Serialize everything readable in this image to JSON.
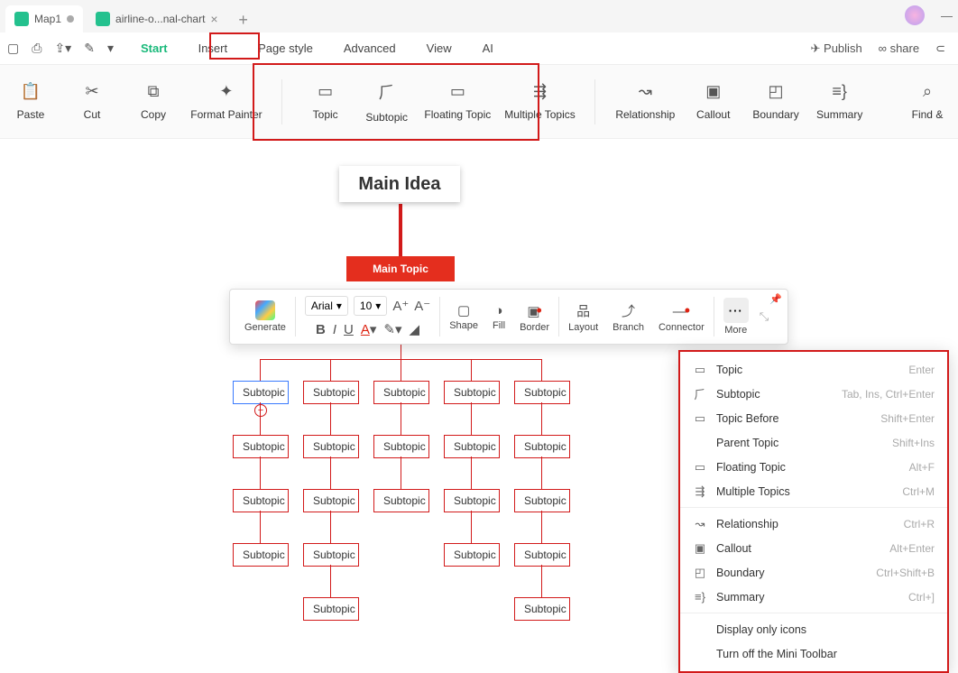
{
  "tabs": [
    {
      "label": "Map1",
      "active": true,
      "dirty": true
    },
    {
      "label": "airline-o...nal-chart",
      "active": false,
      "dirty": false
    }
  ],
  "menu": {
    "items": [
      "Start",
      "Insert",
      "Page style",
      "Advanced",
      "View",
      "AI"
    ],
    "active": "Start",
    "publish": "Publish",
    "share": "share"
  },
  "ribbon": [
    {
      "id": "paste",
      "label": "Paste"
    },
    {
      "id": "cut",
      "label": "Cut"
    },
    {
      "id": "copy",
      "label": "Copy"
    },
    {
      "id": "format-painter",
      "label": "Format Painter"
    },
    {
      "id": "topic",
      "label": "Topic"
    },
    {
      "id": "subtopic",
      "label": "Subtopic"
    },
    {
      "id": "floating-topic",
      "label": "Floating Topic"
    },
    {
      "id": "multiple-topics",
      "label": "Multiple Topics"
    },
    {
      "id": "relationship",
      "label": "Relationship"
    },
    {
      "id": "callout",
      "label": "Callout"
    },
    {
      "id": "boundary",
      "label": "Boundary"
    },
    {
      "id": "summary",
      "label": "Summary"
    },
    {
      "id": "find",
      "label": "Find &"
    }
  ],
  "canvas": {
    "main_idea": "Main Idea",
    "main_topic": "Main Topic",
    "subtopic": "Subtopic"
  },
  "minibar": {
    "generate": "Generate",
    "font": "Arial",
    "size": "10",
    "shape": "Shape",
    "fill": "Fill",
    "border": "Border",
    "layout": "Layout",
    "branch": "Branch",
    "connector": "Connector",
    "more": "More"
  },
  "context_menu": [
    {
      "icon": "topic",
      "label": "Topic",
      "shortcut": "Enter"
    },
    {
      "icon": "subtopic",
      "label": "Subtopic",
      "shortcut": "Tab, Ins, Ctrl+Enter"
    },
    {
      "icon": "topic-before",
      "label": "Topic Before",
      "shortcut": "Shift+Enter"
    },
    {
      "icon": "",
      "label": "Parent Topic",
      "shortcut": "Shift+Ins"
    },
    {
      "icon": "floating",
      "label": "Floating Topic",
      "shortcut": "Alt+F"
    },
    {
      "icon": "multiple",
      "label": "Multiple Topics",
      "shortcut": "Ctrl+M"
    },
    {
      "sep": true
    },
    {
      "icon": "relationship",
      "label": "Relationship",
      "shortcut": "Ctrl+R"
    },
    {
      "icon": "callout",
      "label": "Callout",
      "shortcut": "Alt+Enter"
    },
    {
      "icon": "boundary",
      "label": "Boundary",
      "shortcut": "Ctrl+Shift+B"
    },
    {
      "icon": "summary",
      "label": "Summary",
      "shortcut": "Ctrl+]"
    },
    {
      "sep": true
    },
    {
      "icon": "",
      "label": "Display only icons",
      "shortcut": ""
    },
    {
      "icon": "",
      "label": "Turn off the Mini Toolbar",
      "shortcut": ""
    }
  ]
}
